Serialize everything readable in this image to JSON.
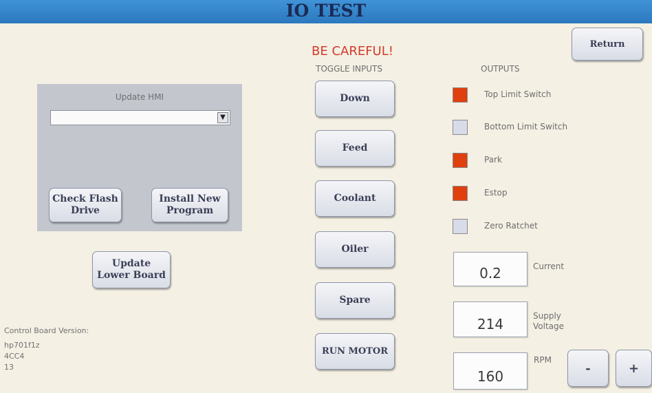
{
  "window": {
    "title": "IO TEST"
  },
  "header": {
    "return_label": "Return",
    "warning": "BE CAREFUL!"
  },
  "update_panel": {
    "title": "Update HMI",
    "dropdown_value": "",
    "check_flash_label": "Check Flash Drive",
    "install_program_label": "Install New Program"
  },
  "update_lower_board_label": "Update Lower Board",
  "toggle_inputs": {
    "heading": "TOGGLE INPUTS",
    "buttons": [
      "Down",
      "Feed",
      "Coolant",
      "Oiler",
      "Spare",
      "RUN MOTOR"
    ]
  },
  "outputs": {
    "heading": "OUTPUTS",
    "items": [
      {
        "label": "Top Limit Switch",
        "state": "on"
      },
      {
        "label": "Bottom Limit Switch",
        "state": "off"
      },
      {
        "label": "Park",
        "state": "on"
      },
      {
        "label": "Estop",
        "state": "on"
      },
      {
        "label": "Zero Ratchet",
        "state": "off"
      }
    ]
  },
  "readouts": {
    "current": {
      "value": "0.2",
      "label": "Current"
    },
    "supply_voltage": {
      "value": "214",
      "label": "Supply Voltage"
    },
    "rpm": {
      "value": "160",
      "label": "RPM"
    }
  },
  "rpm_controls": {
    "minus_label": "-",
    "plus_label": "+"
  },
  "version": {
    "heading": "Control Board Version:",
    "lines": [
      "hp701f1z",
      "4CC4",
      "13"
    ]
  },
  "colors": {
    "on": "#e0400e",
    "off": "#d8dbe8",
    "title_bar": "#2c78be",
    "warning": "#d53a2b"
  }
}
